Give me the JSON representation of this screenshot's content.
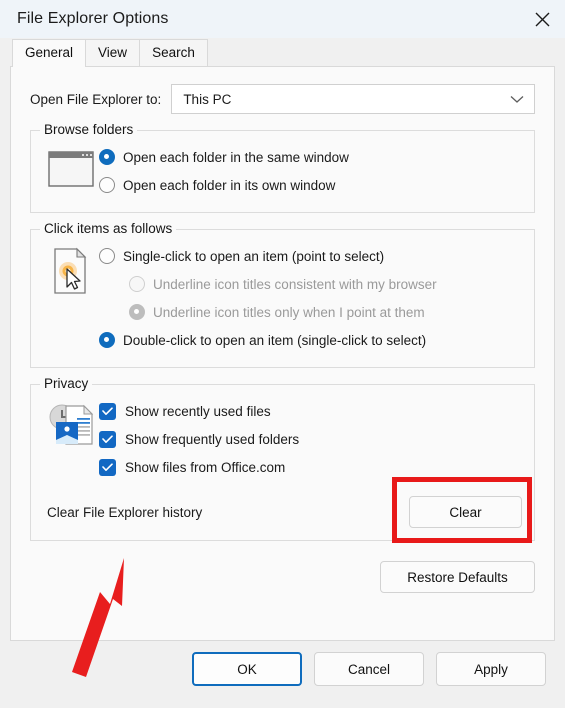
{
  "window": {
    "title": "File Explorer Options",
    "close_icon": "close-icon"
  },
  "tabs": [
    {
      "label": "General",
      "active": true
    },
    {
      "label": "View",
      "active": false
    },
    {
      "label": "Search",
      "active": false
    }
  ],
  "open_to": {
    "label": "Open File Explorer to:",
    "value": "This PC",
    "chevron_icon": "chevron-down-icon"
  },
  "browse_folders": {
    "title": "Browse folders",
    "icon": "window-folder-icon",
    "options": [
      {
        "label": "Open each folder in the same window",
        "checked": true,
        "disabled": false
      },
      {
        "label": "Open each folder in its own window",
        "checked": false,
        "disabled": false
      }
    ]
  },
  "click_items": {
    "title": "Click items as follows",
    "icon": "document-pointer-icon",
    "options": [
      {
        "label": "Single-click to open an item (point to select)",
        "checked": false,
        "disabled": false,
        "indent": false
      },
      {
        "label": "Underline icon titles consistent with my browser",
        "checked": false,
        "disabled": true,
        "indent": true
      },
      {
        "label": "Underline icon titles only when I point at them",
        "checked": true,
        "disabled": true,
        "indent": true
      },
      {
        "label": "Double-click to open an item (single-click to select)",
        "checked": true,
        "disabled": false,
        "indent": false
      }
    ]
  },
  "privacy": {
    "title": "Privacy",
    "icon": "recent-files-icon",
    "checkboxes": [
      {
        "label": "Show recently used files",
        "checked": true
      },
      {
        "label": "Show frequently used folders",
        "checked": true
      },
      {
        "label": "Show files from Office.com",
        "checked": true
      }
    ],
    "clear_history_label": "Clear File Explorer history",
    "clear_button": "Clear"
  },
  "restore_defaults_button": "Restore Defaults",
  "footer": {
    "ok": "OK",
    "cancel": "Cancel",
    "apply": "Apply"
  },
  "annotations": {
    "highlight_color": "#e81919",
    "arrow_color": "#e81e1e",
    "arrow_target": "Clear File Explorer history"
  }
}
